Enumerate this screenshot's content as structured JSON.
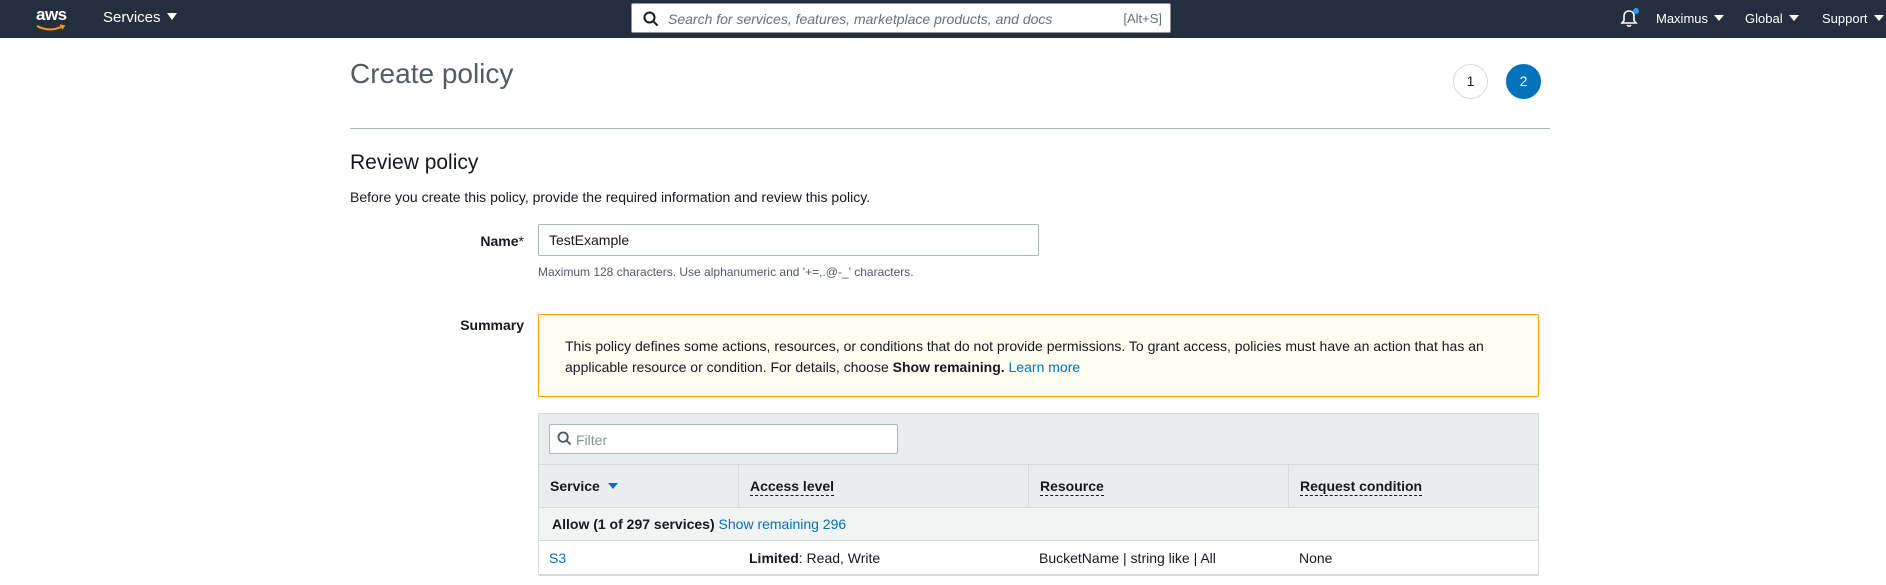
{
  "topnav": {
    "logo_text": "aws",
    "services_label": "Services",
    "search_placeholder": "Search for services, features, marketplace products, and docs",
    "search_shortcut": "[Alt+S]",
    "user_label": "Maximus",
    "region_label": "Global",
    "support_label": "Support"
  },
  "page": {
    "title": "Create policy",
    "steps": [
      "1",
      "2"
    ],
    "active_step": "2"
  },
  "review": {
    "title": "Review policy",
    "intro": "Before you create this policy, provide the required information and review this policy.",
    "name_label": "Name",
    "name_required_mark": "*",
    "name_value": "TestExample",
    "name_hint": "Maximum 128 characters. Use alphanumeric and '+=,.@-_' characters.",
    "summary_label": "Summary"
  },
  "alert": {
    "text": "This policy defines some actions, resources, or conditions that do not provide permissions. To grant access, policies must have an action that has an applicable resource or condition. For details, choose ",
    "bold_text": "Show remaining.",
    "link_text": "Learn more"
  },
  "table": {
    "filter_placeholder": "Filter",
    "columns": [
      "Service",
      "Access level",
      "Resource",
      "Request condition"
    ],
    "group": {
      "label": "Allow (1 of 297 services)",
      "link": "Show remaining 296"
    },
    "rows": [
      {
        "service": "S3",
        "access_bold": "Limited",
        "access_rest": ": Read, Write",
        "resource": "BucketName | string like | All",
        "condition": "None"
      }
    ]
  },
  "colors": {
    "nav_bg": "#232f3e",
    "link": "#0073bb",
    "alert_border": "#ff9900",
    "alert_bg": "#fffcf0"
  }
}
